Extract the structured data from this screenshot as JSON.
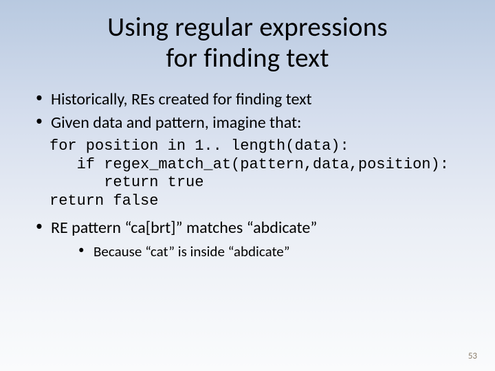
{
  "title_line1": "Using regular expressions",
  "title_line2": "for finding text",
  "bullets": {
    "b1": "Historically, REs created for finding text",
    "b2": "Given data and pattern, imagine that:",
    "b3": "RE pattern “ca[brt]” matches “abdicate”",
    "sub1": "Because “cat” is inside “abdicate”"
  },
  "code": "for position in 1.. length(data):\n   if regex_match_at(pattern,data,position):\n      return true\nreturn false",
  "page_number": "53"
}
